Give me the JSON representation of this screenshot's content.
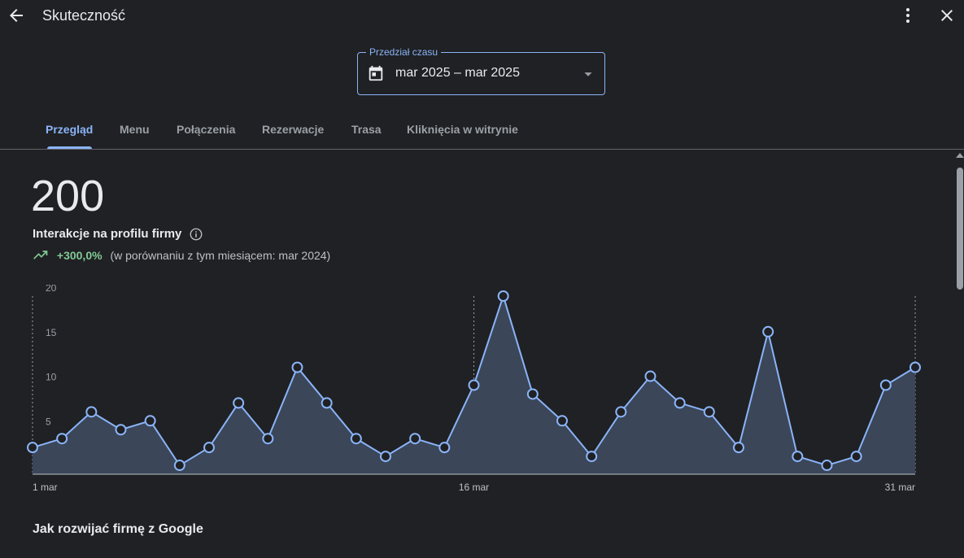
{
  "header": {
    "title": "Skuteczność",
    "back_icon": "arrow-back-icon",
    "more_icon": "more-vert-icon",
    "close_icon": "close-icon"
  },
  "date_range": {
    "label": "Przedział czasu",
    "value": "mar 2025 – mar 2025",
    "icon": "calendar-icon"
  },
  "tabs": [
    {
      "label": "Przegląd",
      "active": true
    },
    {
      "label": "Menu"
    },
    {
      "label": "Połączenia"
    },
    {
      "label": "Rezerwacje"
    },
    {
      "label": "Trasa"
    },
    {
      "label": "Kliknięcia w witrynie"
    }
  ],
  "metric": {
    "value": "200",
    "label": "Interakcje na profilu firmy",
    "change": "+300,0%",
    "comparison": "(w porównaniu z tym miesiącem: mar 2024)"
  },
  "colors": {
    "accent": "#8ab4f8",
    "positive": "#81c995",
    "background": "#202124",
    "area_fill": "#3b4659"
  },
  "chart_data": {
    "type": "area",
    "x": [
      1,
      2,
      3,
      4,
      5,
      6,
      7,
      8,
      9,
      10,
      11,
      12,
      13,
      14,
      15,
      16,
      17,
      18,
      19,
      20,
      21,
      22,
      23,
      24,
      25,
      26,
      27,
      28,
      29,
      30,
      31
    ],
    "values": [
      3,
      4,
      7,
      5,
      6,
      1,
      3,
      8,
      4,
      12,
      8,
      4,
      2,
      4,
      3,
      10,
      20,
      9,
      6,
      2,
      7,
      11,
      8,
      7,
      3,
      16,
      2,
      1,
      2,
      10,
      12
    ],
    "y_ticks": [
      "5",
      "10",
      "15",
      "20"
    ],
    "ylim": [
      0,
      20
    ],
    "x_tick_labels": [
      "1 mar",
      "16 mar",
      "31 mar"
    ],
    "x_tick_days": [
      1,
      16,
      31
    ]
  },
  "sections": {
    "grow_title": "Jak rozwijać firmę z Google"
  }
}
